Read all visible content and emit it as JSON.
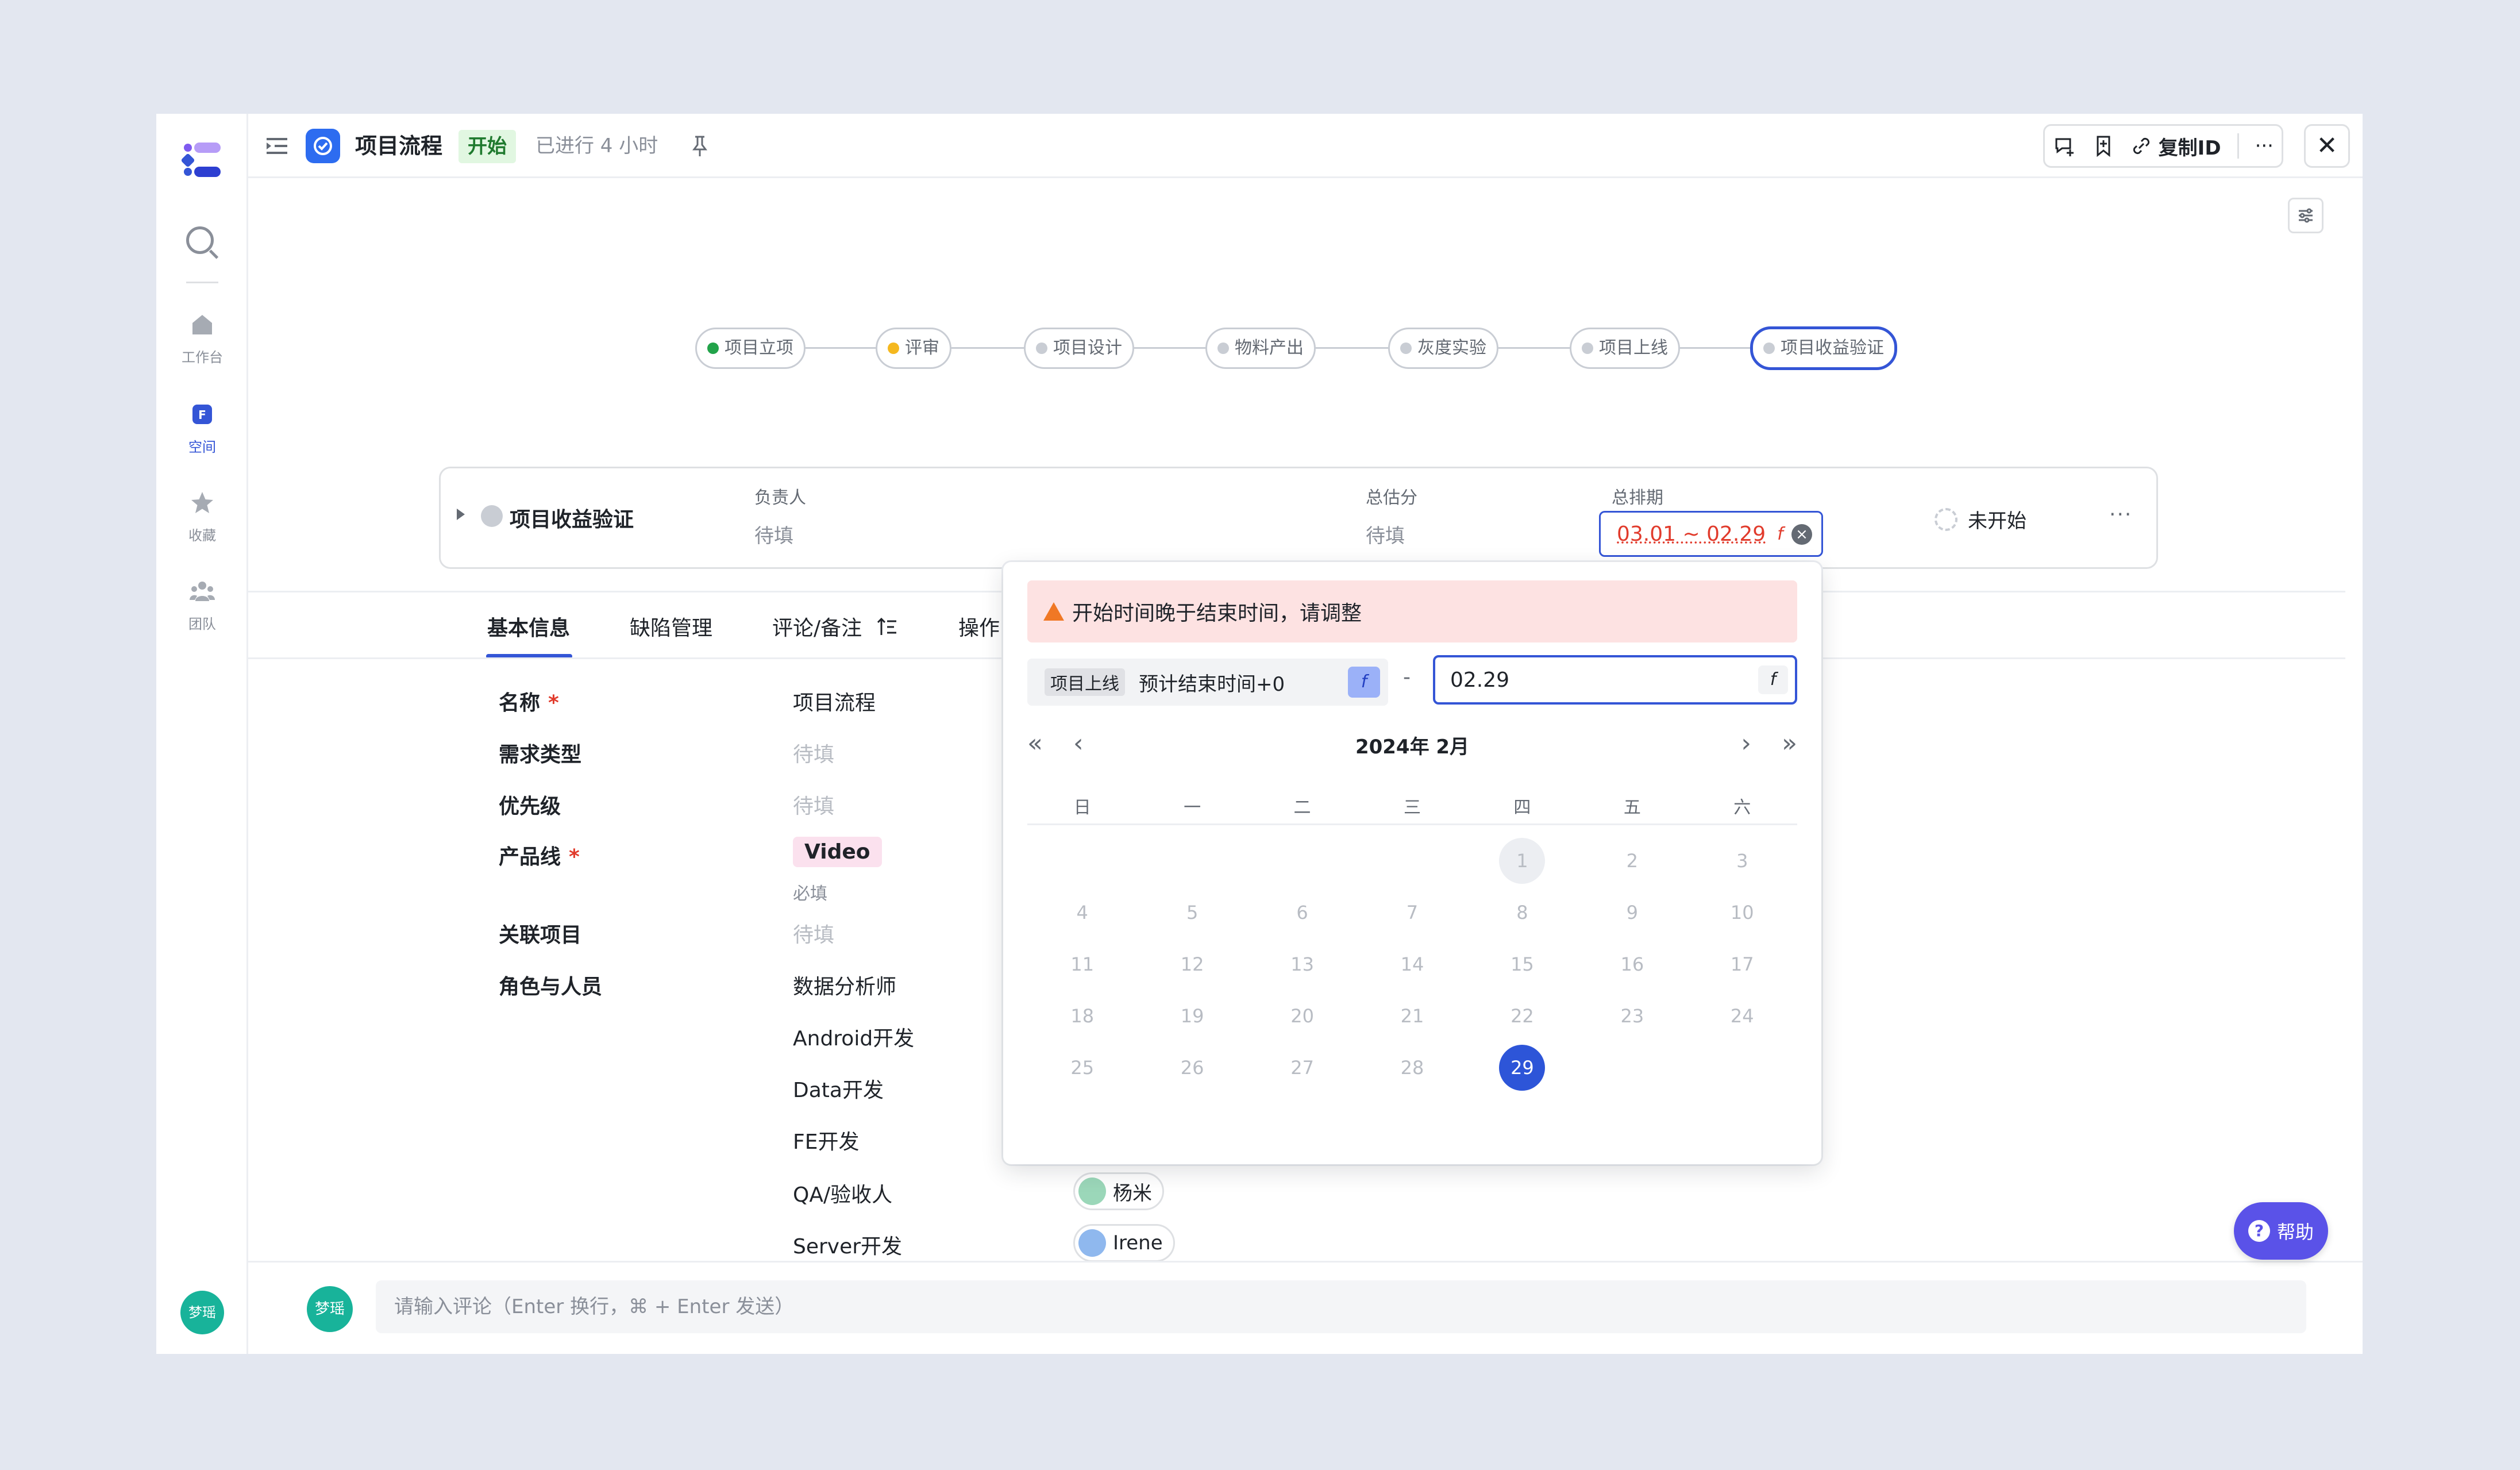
{
  "header": {
    "title": "项目流程",
    "status_tag": "开始",
    "elapsed": "已进行 4 小时",
    "copy_id_label": "复制ID"
  },
  "sidebar": {
    "items": [
      {
        "label": "工作台"
      },
      {
        "label": "空间"
      },
      {
        "label": "收藏"
      },
      {
        "label": "团队"
      }
    ],
    "user_avatar_text": "梦瑶"
  },
  "flow": {
    "nodes": [
      {
        "label": "项目立项",
        "dot_color": "#22a34a"
      },
      {
        "label": "评审",
        "dot_color": "#f5b81f"
      },
      {
        "label": "项目设计",
        "dot_color": "#c9cdd4"
      },
      {
        "label": "物料产出",
        "dot_color": "#c9cdd4"
      },
      {
        "label": "灰度实验",
        "dot_color": "#c9cdd4"
      },
      {
        "label": "项目上线",
        "dot_color": "#c9cdd4"
      },
      {
        "label": "项目收益验证",
        "dot_color": "#c9cdd4"
      }
    ]
  },
  "task": {
    "name": "项目收益验证",
    "owner_label": "负责人",
    "owner_value": "待填",
    "estimate_label": "总估分",
    "estimate_value": "待填",
    "schedule_label": "总排期",
    "schedule_value": "03.01 ~ 02.29",
    "schedule_fn": "f",
    "progress": "未开始",
    "more": "···"
  },
  "tabs": [
    {
      "label": "基本信息"
    },
    {
      "label": "缺陷管理"
    },
    {
      "label": "评论/备注"
    },
    {
      "label": "操作"
    }
  ],
  "fields": {
    "name_label": "名称",
    "name_value": "项目流程",
    "type_label": "需求类型",
    "type_value": "待填",
    "priority_label": "优先级",
    "priority_value": "待填",
    "product_label": "产品线",
    "product_value": "Video",
    "product_hint": "必填",
    "related_label": "关联项目",
    "related_value": "待填",
    "roles_label": "角色与人员",
    "required_mark": "*",
    "roles": [
      {
        "role": "数据分析师"
      },
      {
        "role": "Android开发"
      },
      {
        "role": "Data开发"
      },
      {
        "role": "FE开发"
      },
      {
        "role": "QA/验收人",
        "person": "杨米"
      },
      {
        "role": "Server开发",
        "person": "Irene"
      }
    ]
  },
  "popover": {
    "error": "开始时间晚于结束时间，请调整",
    "start_tag": "项目上线",
    "start_text": "预计结束时间+0",
    "dash": "-",
    "end_value": "02.29",
    "fn_label": "f",
    "calendar_title": "2024年 2月",
    "weekdays": [
      "日",
      "一",
      "二",
      "三",
      "四",
      "五",
      "六"
    ],
    "leading_blanks": 4,
    "days": [
      "1",
      "2",
      "3",
      "4",
      "5",
      "6",
      "7",
      "8",
      "9",
      "10",
      "11",
      "12",
      "13",
      "14",
      "15",
      "16",
      "17",
      "18",
      "19",
      "20",
      "21",
      "22",
      "23",
      "24",
      "25",
      "26",
      "27",
      "28",
      "29"
    ],
    "today": "1",
    "selected": "29",
    "nav_prev_year": "«",
    "nav_prev_month": "‹",
    "nav_next_month": "›",
    "nav_next_year": "»"
  },
  "comment": {
    "avatar_text": "梦瑶",
    "placeholder": "请输入评论（Enter 换行，⌘ + Enter 发送）"
  },
  "help": {
    "label": "帮助"
  },
  "colors": {
    "accent": "#3455d6",
    "error_bg": "#fde2e2",
    "error_text": "#e13b2c"
  }
}
